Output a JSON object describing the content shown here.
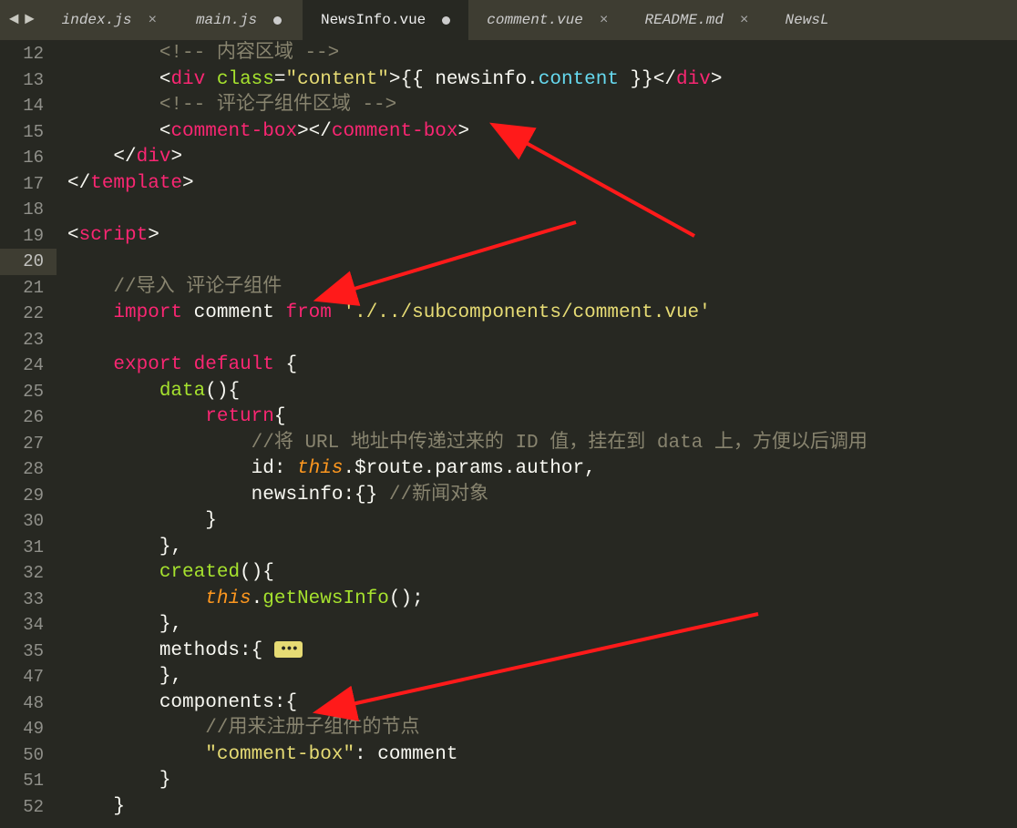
{
  "nav": {
    "back": "◄",
    "forward": "►"
  },
  "tabs": [
    {
      "label": "index.js",
      "active": false,
      "dirty": false
    },
    {
      "label": "main.js",
      "active": false,
      "dirty": true
    },
    {
      "label": "NewsInfo.vue",
      "active": true,
      "dirty": true
    },
    {
      "label": "comment.vue",
      "active": false,
      "dirty": false
    },
    {
      "label": "README.md",
      "active": false,
      "dirty": false
    },
    {
      "label": "NewsL",
      "active": false,
      "dirty": false,
      "overflow": true
    }
  ],
  "gutter": [
    "12",
    "13",
    "14",
    "15",
    "16",
    "17",
    "18",
    "19",
    "20",
    "21",
    "22",
    "23",
    "24",
    "25",
    "26",
    "27",
    "28",
    "29",
    "30",
    "31",
    "32",
    "33",
    "34",
    "35",
    "47",
    "48",
    "49",
    "50",
    "51",
    "52"
  ],
  "highlight_line_index": 8,
  "code_tokens": [
    [
      [
        "        ",
        ""
      ],
      [
        "<!-- 内容区域 -->",
        "c-comment"
      ]
    ],
    [
      [
        "        ",
        ""
      ],
      [
        "<",
        "c-punct"
      ],
      [
        "div",
        "c-tag"
      ],
      [
        " ",
        ""
      ],
      [
        "class",
        "c-attr"
      ],
      [
        "=",
        "c-punct"
      ],
      [
        "\"content\"",
        "c-string"
      ],
      [
        ">",
        "c-punct"
      ],
      [
        "{{ newsinfo",
        ""
      ],
      [
        ".",
        ""
      ],
      [
        "content",
        "c-member"
      ],
      [
        " }}",
        ""
      ],
      [
        "</",
        "c-punct"
      ],
      [
        "div",
        "c-tag"
      ],
      [
        ">",
        "c-punct"
      ]
    ],
    [
      [
        "        ",
        ""
      ],
      [
        "<!-- 评论子组件区域 -->",
        "c-comment"
      ]
    ],
    [
      [
        "        ",
        ""
      ],
      [
        "<",
        "c-punct"
      ],
      [
        "comment-box",
        "c-tag"
      ],
      [
        ">",
        "c-punct"
      ],
      [
        "</",
        "c-punct"
      ],
      [
        "comment-box",
        "c-tag"
      ],
      [
        ">",
        "c-punct"
      ]
    ],
    [
      [
        "    ",
        ""
      ],
      [
        "</",
        "c-punct"
      ],
      [
        "div",
        "c-tag"
      ],
      [
        ">",
        "c-punct"
      ]
    ],
    [
      [
        "</",
        "c-punct"
      ],
      [
        "template",
        "c-tag"
      ],
      [
        ">",
        "c-punct"
      ]
    ],
    [
      [
        "",
        ""
      ]
    ],
    [
      [
        "<",
        "c-punct"
      ],
      [
        "script",
        "c-tag"
      ],
      [
        ">",
        "c-punct"
      ]
    ],
    [
      [
        "",
        ""
      ]
    ],
    [
      [
        "    ",
        ""
      ],
      [
        "//导入 评论子组件",
        "c-comment"
      ]
    ],
    [
      [
        "    ",
        ""
      ],
      [
        "import",
        "c-keyword"
      ],
      [
        " comment ",
        ""
      ],
      [
        "from",
        "c-keyword"
      ],
      [
        " ",
        ""
      ],
      [
        "'./../subcomponents/comment.vue'",
        "c-string"
      ]
    ],
    [
      [
        "",
        ""
      ]
    ],
    [
      [
        "    ",
        ""
      ],
      [
        "export",
        "c-keyword"
      ],
      [
        " ",
        ""
      ],
      [
        "default",
        "c-keyword"
      ],
      [
        " {",
        ""
      ]
    ],
    [
      [
        "        ",
        ""
      ],
      [
        "data",
        "c-func"
      ],
      [
        "(){",
        ""
      ]
    ],
    [
      [
        "            ",
        ""
      ],
      [
        "return",
        "c-keyword"
      ],
      [
        "{",
        ""
      ]
    ],
    [
      [
        "                ",
        ""
      ],
      [
        "//将 URL 地址中传递过来的 ID 值，挂在到 data 上，方便以后调用",
        "c-comment"
      ]
    ],
    [
      [
        "                id: ",
        ""
      ],
      [
        "this",
        "c-this"
      ],
      [
        ".$route.params.author,",
        ""
      ]
    ],
    [
      [
        "                newsinfo:{} ",
        ""
      ],
      [
        "//新闻对象",
        "c-comment"
      ]
    ],
    [
      [
        "            }",
        ""
      ]
    ],
    [
      [
        "        },",
        ""
      ]
    ],
    [
      [
        "        ",
        ""
      ],
      [
        "created",
        "c-func"
      ],
      [
        "(){",
        ""
      ]
    ],
    [
      [
        "            ",
        ""
      ],
      [
        "this",
        "c-this"
      ],
      [
        ".",
        ""
      ],
      [
        "getNewsInfo",
        "c-func"
      ],
      [
        "();",
        ""
      ]
    ],
    [
      [
        "        },",
        ""
      ]
    ],
    [
      [
        "        methods:{ ",
        ""
      ],
      [
        "FOLD",
        "fold"
      ]
    ],
    [
      [
        "        },",
        ""
      ]
    ],
    [
      [
        "        components:{",
        ""
      ]
    ],
    [
      [
        "            ",
        ""
      ],
      [
        "//用来注册子组件的节点",
        "c-comment"
      ]
    ],
    [
      [
        "            ",
        ""
      ],
      [
        "\"comment-box\"",
        "c-string"
      ],
      [
        ": comment",
        ""
      ]
    ],
    [
      [
        "        }",
        ""
      ]
    ],
    [
      [
        "    }",
        ""
      ]
    ]
  ],
  "fold_marker": "•••"
}
